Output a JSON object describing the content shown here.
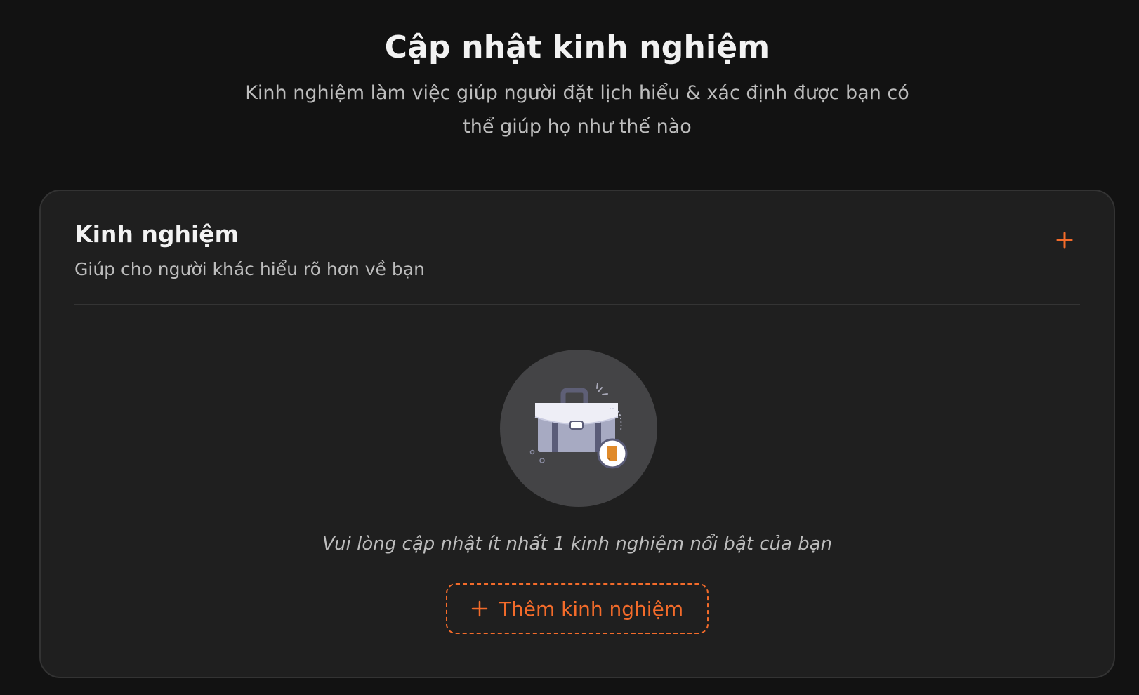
{
  "header": {
    "title": "Cập nhật kinh nghiệm",
    "subtitle_line1": "Kinh nghiệm làm việc giúp người đặt lịch hiểu & xác định được bạn có",
    "subtitle_line2": "thể giúp họ như thế nào"
  },
  "experience_card": {
    "title": "Kinh nghiệm",
    "subtitle": "Giúp cho người khác hiểu rõ hơn về bạn",
    "add_icon": "plus-icon",
    "empty_state": {
      "illustration": "briefcase-icon",
      "message": "Vui lòng cập nhật ít nhất 1 kinh nghiệm nổi bật của bạn",
      "button_label": "Thêm kinh nghiệm",
      "button_icon": "plus-icon"
    }
  },
  "colors": {
    "background": "#121212",
    "card_background": "#1f1f1f",
    "card_border": "#333333",
    "accent": "#f36b2a",
    "text_primary": "#f2f2f2",
    "text_secondary": "#bdbdbd",
    "illustration_circle": "#444446"
  }
}
